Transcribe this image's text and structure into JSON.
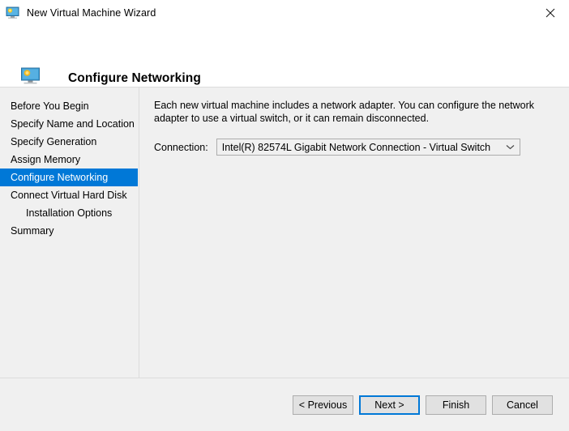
{
  "titlebar": {
    "icon": "virtual-machine-monitor-icon",
    "title": "New Virtual Machine Wizard",
    "close_label": "✕"
  },
  "header": {
    "icon": "virtual-machine-monitor-icon",
    "title": "Configure Networking"
  },
  "sidebar": {
    "items": [
      {
        "label": "Before You Begin",
        "selected": false,
        "indent": false
      },
      {
        "label": "Specify Name and Location",
        "selected": false,
        "indent": false
      },
      {
        "label": "Specify Generation",
        "selected": false,
        "indent": false
      },
      {
        "label": "Assign Memory",
        "selected": false,
        "indent": false
      },
      {
        "label": "Configure Networking",
        "selected": true,
        "indent": false
      },
      {
        "label": "Connect Virtual Hard Disk",
        "selected": false,
        "indent": false
      },
      {
        "label": "Installation Options",
        "selected": false,
        "indent": true
      },
      {
        "label": "Summary",
        "selected": false,
        "indent": false
      }
    ]
  },
  "main": {
    "description": "Each new virtual machine includes a network adapter. You can configure the network adapter to use a virtual switch, or it can remain disconnected.",
    "connection_label": "Connection:",
    "connection_value": "Intel(R) 82574L Gigabit Network Connection - Virtual Switch",
    "connection_options": [
      "Intel(R) 82574L Gigabit Network Connection - Virtual Switch"
    ]
  },
  "footer": {
    "previous_label": "< Previous",
    "next_label": "Next >",
    "finish_label": "Finish",
    "cancel_label": "Cancel"
  },
  "colors": {
    "accent": "#0078d7",
    "window_background": "#f0f0f0",
    "header_background": "#ffffff",
    "border": "#dcdcdc",
    "button_face": "#e1e1e1",
    "button_border": "#adadad"
  }
}
